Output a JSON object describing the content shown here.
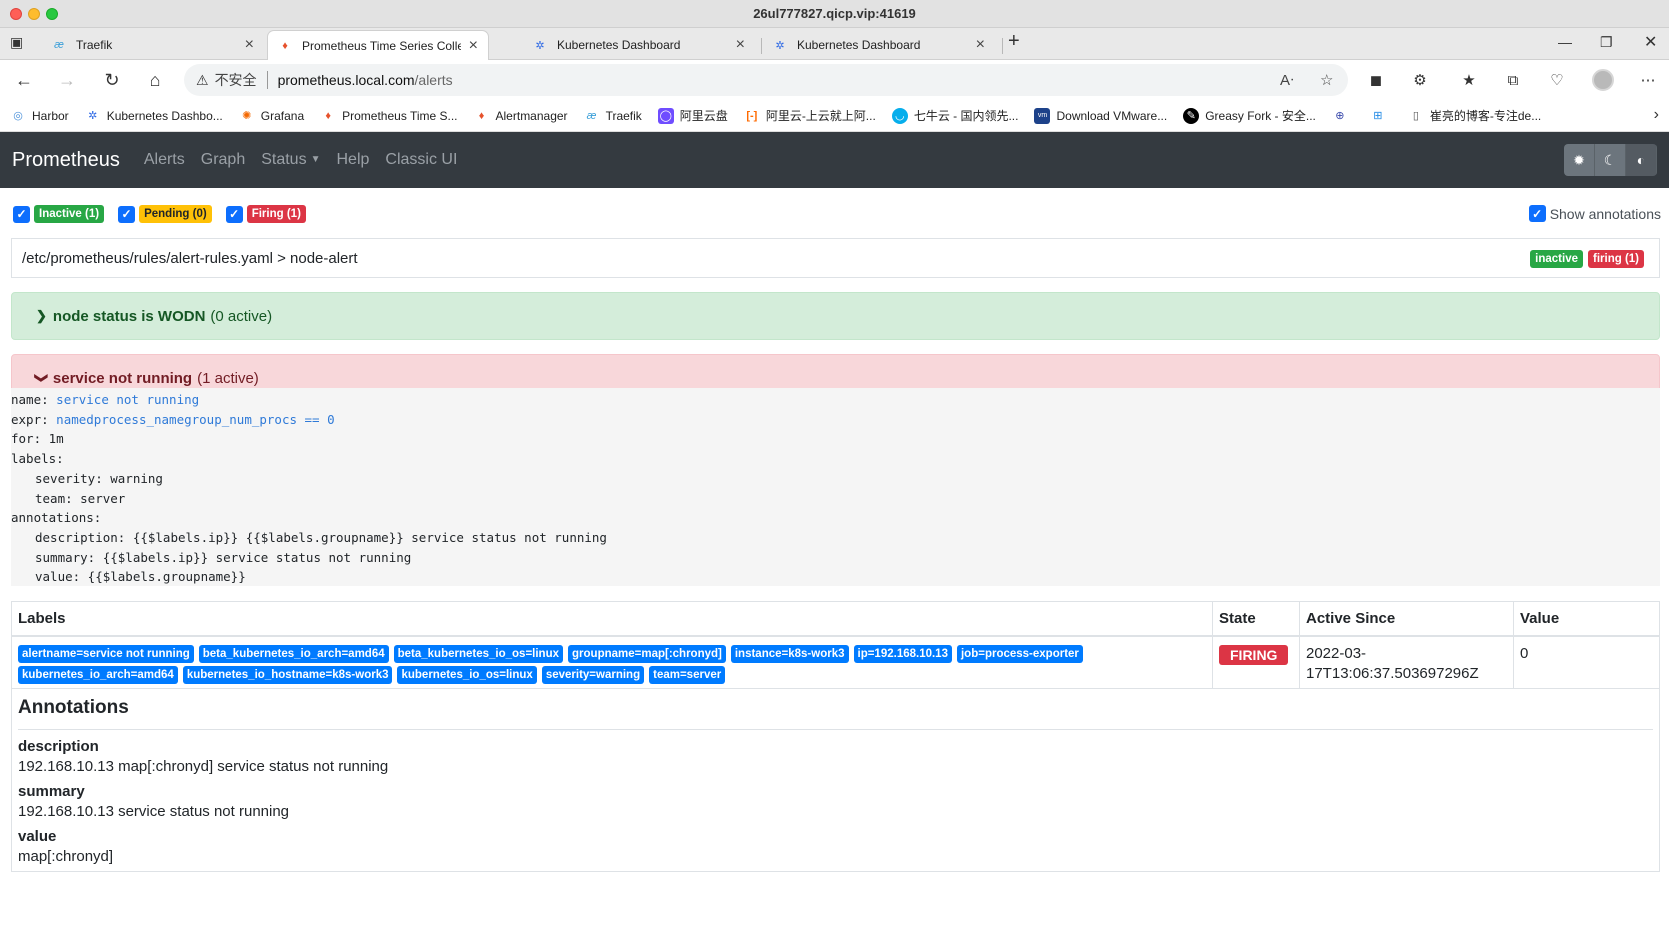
{
  "window": {
    "title": "26ul777827.qicp.vip:41619"
  },
  "tabs": [
    {
      "title": "Traefik",
      "icon": "traefik-icon"
    },
    {
      "title": "Prometheus Time Series Collecti",
      "icon": "prometheus-icon"
    },
    {
      "title": "Kubernetes Dashboard",
      "icon": "kubernetes-icon"
    },
    {
      "title": "Kubernetes Dashboard",
      "icon": "kubernetes-icon"
    }
  ],
  "addressbar": {
    "security_label": "不安全",
    "url_host": "prometheus.local.com",
    "url_path": "/alerts"
  },
  "bookmarks": [
    {
      "label": "Harbor"
    },
    {
      "label": "Kubernetes Dashbo..."
    },
    {
      "label": "Grafana"
    },
    {
      "label": "Prometheus Time S..."
    },
    {
      "label": "Alertmanager"
    },
    {
      "label": "Traefik"
    },
    {
      "label": "阿里云盘"
    },
    {
      "label": "阿里云-上云就上阿..."
    },
    {
      "label": "七牛云 - 国内领先..."
    },
    {
      "label": "Download VMware..."
    },
    {
      "label": "Greasy Fork - 安全..."
    },
    {
      "label": ""
    },
    {
      "label": ""
    },
    {
      "label": "崔亮的博客-专注de..."
    }
  ],
  "navbar": {
    "brand": "Prometheus",
    "links": [
      "Alerts",
      "Graph",
      "Status",
      "Help",
      "Classic UI"
    ]
  },
  "filters": {
    "inactive": "Inactive (1)",
    "pending": "Pending (0)",
    "firing": "Firing (1)",
    "show_annotations": "Show annotations"
  },
  "rule_group": {
    "path": "/etc/prometheus/rules/alert-rules.yaml > node-alert",
    "badge_inactive": "inactive",
    "badge_firing": "firing (1)"
  },
  "alerts": [
    {
      "name": "node status is WODN",
      "active": "(0 active)"
    },
    {
      "name": "service not running",
      "active": "(1 active)"
    }
  ],
  "rule_def": {
    "name_key": "name:",
    "name_val": "service not running",
    "expr_key": "expr:",
    "expr_val": "namedprocess_namegroup_num_procs == 0",
    "for": "for: 1m",
    "labels": "labels:",
    "severity": "severity: warning",
    "team": "team: server",
    "annotations": "annotations:",
    "description": "description: {{$labels.ip}} {{$labels.groupname}} service status not running",
    "summary": "summary: {{$labels.ip}} service status not running",
    "value": "value: {{$labels.groupname}}"
  },
  "table": {
    "headers": [
      "Labels",
      "State",
      "Active Since",
      "Value"
    ],
    "labels": [
      "alertname=service not running",
      "beta_kubernetes_io_arch=amd64",
      "beta_kubernetes_io_os=linux",
      "groupname=map[:chronyd]",
      "instance=k8s-work3",
      "ip=192.168.10.13",
      "job=process-exporter",
      "kubernetes_io_arch=amd64",
      "kubernetes_io_hostname=k8s-work3",
      "kubernetes_io_os=linux",
      "severity=warning",
      "team=server"
    ],
    "state": "FIRING",
    "active_since_line1": "2022-03-",
    "active_since_line2": "17T13:06:37.503697296Z",
    "value": "0"
  },
  "annotations_panel": {
    "title": "Annotations",
    "items": [
      {
        "key": "description",
        "value": "192.168.10.13 map[:chronyd] service status not running"
      },
      {
        "key": "summary",
        "value": "192.168.10.13 service status not running"
      },
      {
        "key": "value",
        "value": "map[:chronyd]"
      }
    ]
  }
}
